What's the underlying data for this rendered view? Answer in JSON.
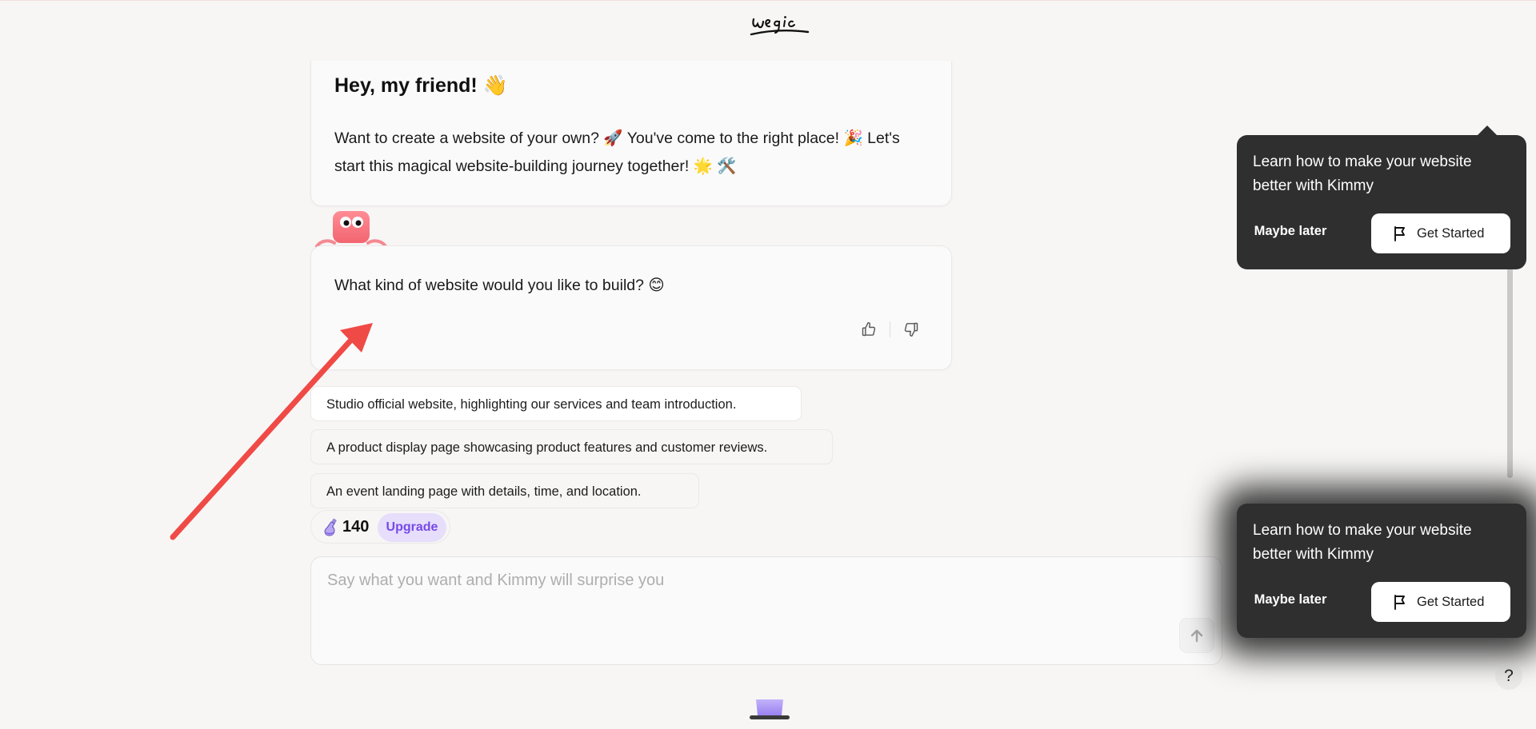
{
  "app": {
    "logo_text": "Wegic"
  },
  "greeting": {
    "title": "Hey, my friend!",
    "title_emoji": "👋",
    "body": "Want to create a website of your own? 🚀 You've come to the right place! 🎉 Let's start this magical website-building journey together! 🌟 🛠️"
  },
  "question": {
    "text": "What kind of website would you like to build? 😊",
    "like_icon": "thumbs-up-icon",
    "dislike_icon": "thumbs-down-icon"
  },
  "suggestions": [
    {
      "label": "Studio official website, highlighting our services and team introduction."
    },
    {
      "label": "A product display page showcasing product features and customer reviews."
    },
    {
      "label": "An event landing page with details, time, and location."
    }
  ],
  "credits": {
    "count": "140",
    "upgrade_label": "Upgrade"
  },
  "input": {
    "placeholder": "Say what you want and Kimmy will surprise you"
  },
  "tour_popups": [
    {
      "text": "Learn how to make your website better with Kimmy",
      "later_label": "Maybe later",
      "start_label": "Get Started"
    },
    {
      "text": "Learn how to make your website better with Kimmy",
      "later_label": "Maybe later",
      "start_label": "Get Started"
    }
  ],
  "help": {
    "label": "?"
  },
  "colors": {
    "background": "#f7f6f5",
    "accent": "#7749e8",
    "upgrade_bg": "#e6defb",
    "tooltip_bg": "#2f2f2f",
    "annotation_arrow": "#f04a46",
    "mascot_pink": "#f5717b"
  }
}
